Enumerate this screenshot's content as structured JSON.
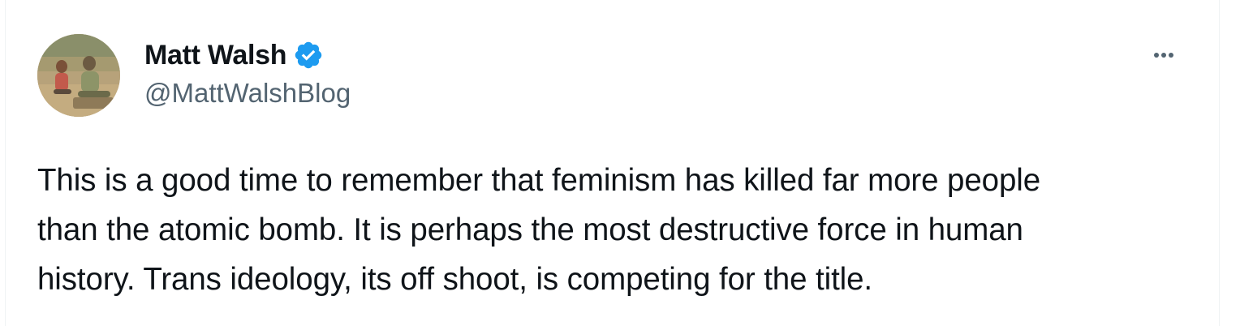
{
  "author": {
    "display_name": "Matt Walsh",
    "handle": "@MattWalshBlog",
    "verified": true,
    "verified_color": "#1d9bf0",
    "avatar_icon": "profile-photo"
  },
  "actions": {
    "more_icon": "more-horizontal-icon"
  },
  "tweet": {
    "lines": [
      "This is a good time to remember that feminism has killed far more people",
      "than the atomic bomb. It is perhaps the most destructive force in human",
      "history. Trans ideology, its off shoot, is competing for the title."
    ]
  },
  "colors": {
    "text_primary": "#0f1419",
    "text_secondary": "#536471",
    "border": "#eff3f4"
  }
}
